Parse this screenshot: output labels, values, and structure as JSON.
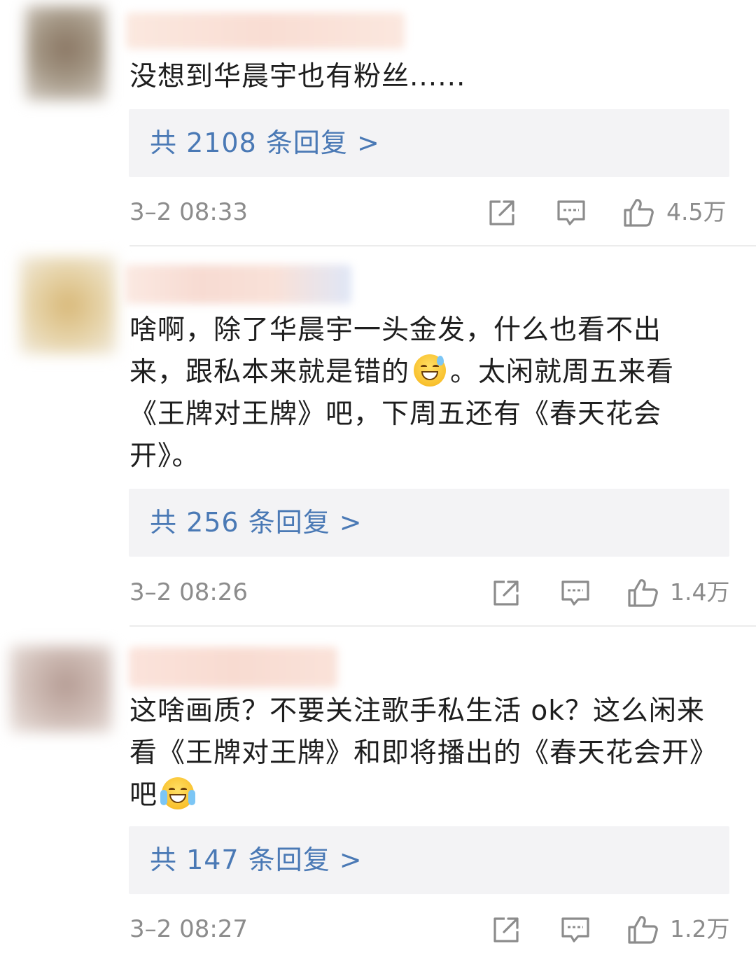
{
  "comments": [
    {
      "text": "没想到华晨宇也有粉丝......",
      "reply_label": "共 2108 条回复 >",
      "time": "3–2 08:33",
      "likes": "4.5万"
    },
    {
      "text_part1": "啥啊，除了华晨宇一头金发，什么也看不出来，跟私本来就是错的",
      "text_part2": "。太闲就周五来看《王牌对王牌》吧，下周五还有《春天花会开》。",
      "emoji": "grinning-sweat-emoji",
      "reply_label": "共 256 条回复 >",
      "time": "3–2 08:26",
      "likes": "1.4万"
    },
    {
      "text_part1": "这啥画质？不要关注歌手私生活 ok？这么闲来看《王牌对王牌》和即将播出的《春天花会开》吧",
      "emoji": "crying-smile-emoji",
      "reply_label": "共 147 条回复 >",
      "time": "3–2 08:27",
      "likes": "1.2万"
    }
  ],
  "icons": {
    "share": "share-icon",
    "comment": "comment-icon",
    "like": "thumbs-up-icon"
  },
  "colors": {
    "link": "#4a79b5",
    "meta": "#8c8c8c",
    "reply_bg": "#f3f3f5"
  }
}
